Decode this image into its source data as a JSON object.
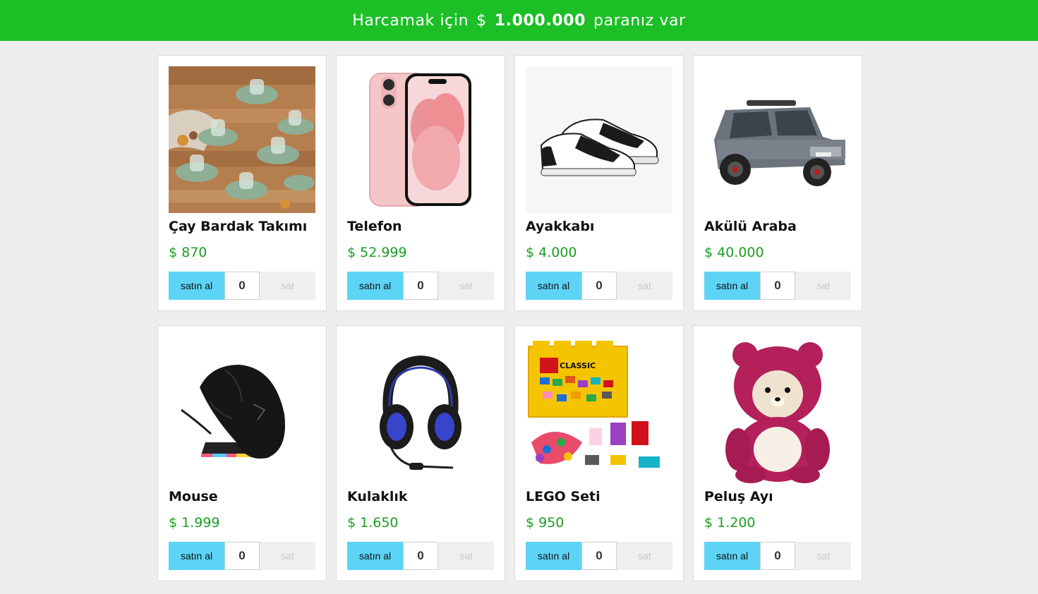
{
  "header": {
    "prefix": "Harcamak için",
    "currency": "$",
    "amount": "1.000.000",
    "suffix": "paranız var",
    "background": "#1cbf26"
  },
  "products": [
    {
      "name": "Çay Bardak Takımı",
      "price": "$ 870",
      "buy_label": "satın al",
      "quantity": "0",
      "sell_label": "sat"
    },
    {
      "name": "Telefon",
      "price": "$ 52.999",
      "buy_label": "satın al",
      "quantity": "0",
      "sell_label": "sat"
    },
    {
      "name": "Ayakkabı",
      "price": "$ 4.000",
      "buy_label": "satın al",
      "quantity": "0",
      "sell_label": "sat"
    },
    {
      "name": "Akülü Araba",
      "price": "$ 40.000",
      "buy_label": "satın al",
      "quantity": "0",
      "sell_label": "sat"
    },
    {
      "name": "Mouse",
      "price": "$ 1.999",
      "buy_label": "satın al",
      "quantity": "0",
      "sell_label": "sat"
    },
    {
      "name": "Kulaklık",
      "price": "$ 1.650",
      "buy_label": "satın al",
      "quantity": "0",
      "sell_label": "sat"
    },
    {
      "name": "LEGO Seti",
      "price": "$ 950",
      "buy_label": "satın al",
      "quantity": "0",
      "sell_label": "sat"
    },
    {
      "name": "Peluş Ayı",
      "price": "$ 1.200",
      "buy_label": "satın al",
      "quantity": "0",
      "sell_label": "sat"
    }
  ],
  "lego_box_text": "CLASSIC",
  "colors": {
    "price": "#1a9e22",
    "buy_button": "#5dd4f6",
    "sell_button": "#efefef"
  }
}
